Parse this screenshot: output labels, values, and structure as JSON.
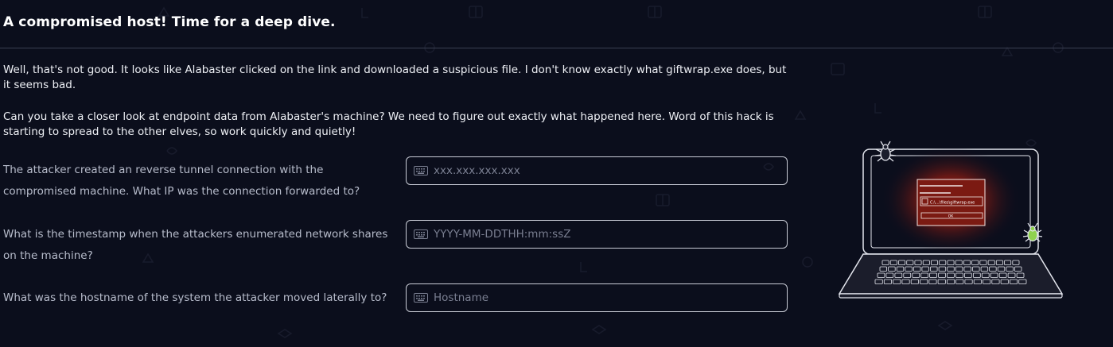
{
  "header": {
    "title": "A compromised host! Time for a deep dive."
  },
  "intro": {
    "paragraph1": "Well, that's not good. It looks like Alabaster clicked on the link and downloaded a suspicious file. I don't know exactly what giftwrap.exe does, but it seems bad.",
    "paragraph2": "Can you take a closer look at endpoint data from Alabaster's machine? We need to figure out exactly what happened here. Word of this hack is starting to spread to the other elves, so work quickly and quietly!"
  },
  "questions": [
    {
      "label": "The attacker created an reverse tunnel connection with the compromised machine. What IP was the connection forwarded to?",
      "placeholder": "xxx.xxx.xxx.xxx",
      "value": ""
    },
    {
      "label": "What is the timestamp when the attackers enumerated network shares on the machine?",
      "placeholder": "YYYY-MM-DDTHH:mm:ssZ",
      "value": ""
    },
    {
      "label": "What was the hostname of the system the attacker moved laterally to?",
      "placeholder": "Hostname",
      "value": ""
    }
  ],
  "illustration": {
    "dialog_path": "C:\\...\\files\\giftwrap.exe",
    "dialog_button": "OK"
  },
  "colors": {
    "background": "#0b0e1c",
    "glow": "#c8281c",
    "bug": "#8fd14f"
  },
  "icons": [
    "keyboard-icon",
    "bug-icon",
    "laptop-illustration"
  ]
}
